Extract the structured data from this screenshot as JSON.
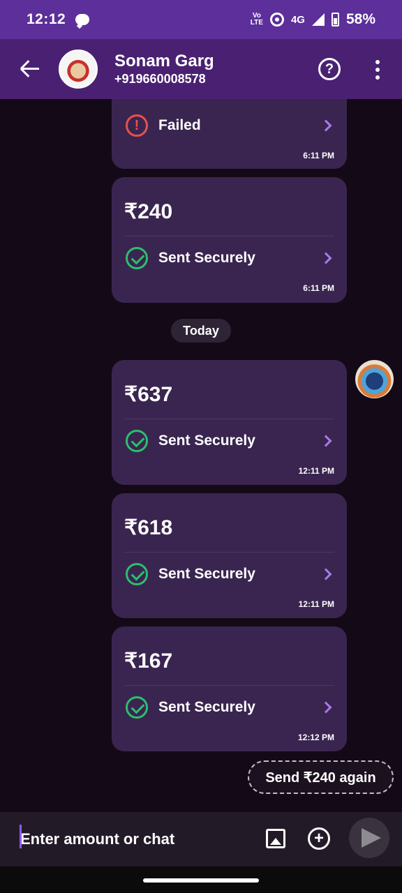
{
  "status_bar": {
    "time": "12:12",
    "volte": "Vo\nLTE",
    "network": "4G",
    "battery": "58%"
  },
  "header": {
    "contact_name": "Sonam Garg",
    "contact_phone": "+919660008578",
    "help_glyph": "?"
  },
  "messages": [
    {
      "amount": "",
      "status": "Failed",
      "time": "6:11 PM",
      "type": "failed"
    },
    {
      "amount": "₹240",
      "status": "Sent Securely",
      "time": "6:11 PM",
      "type": "sent"
    },
    {
      "amount": "₹637",
      "status": "Sent Securely",
      "time": "12:11 PM",
      "type": "sent"
    },
    {
      "amount": "₹618",
      "status": "Sent Securely",
      "time": "12:11 PM",
      "type": "sent"
    },
    {
      "amount": "₹167",
      "status": "Sent Securely",
      "time": "12:12 PM",
      "type": "sent"
    }
  ],
  "date_separator": "Today",
  "resend_label": "Send ₹240 again",
  "composer": {
    "placeholder": "Enter amount or chat"
  },
  "colors": {
    "accent": "#5c2f9a",
    "success": "#2bbf6e",
    "error": "#e5534b",
    "card": "#3a2550"
  },
  "icons": [
    "back-arrow-icon",
    "help-icon",
    "more-vert-icon",
    "error-icon",
    "check-circle-icon",
    "chevron-right-icon",
    "image-icon",
    "add-circle-icon",
    "send-icon"
  ]
}
